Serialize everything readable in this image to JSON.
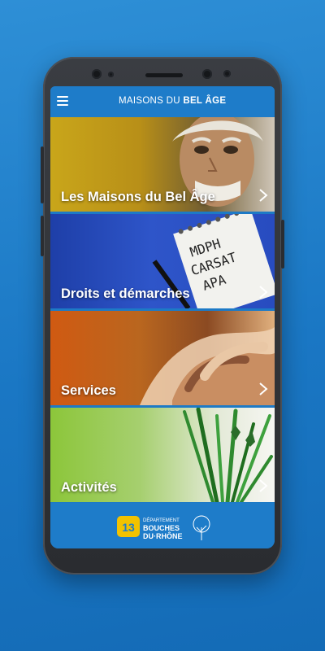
{
  "app": {
    "brand_part1": "MAISONS DU",
    "brand_part2": "BEL ÂGE"
  },
  "tiles": [
    {
      "label": "Les Maisons du Bel Âge"
    },
    {
      "label": "Droits et démarches"
    },
    {
      "label": "Services"
    },
    {
      "label": "Activités"
    }
  ],
  "notepad": {
    "line1": "MDPH",
    "line2": "CARSAT",
    "line3": "APA"
  },
  "footer": {
    "dept_label": "DÉPARTEMENT",
    "dept_name1": "BOUCHES",
    "dept_name2": "DU·RHÔNE",
    "logo_letter": "13"
  },
  "colors": {
    "background": "#1a77c4",
    "app_bar": "#1e7cc9",
    "logo_yellow": "#f2c200"
  }
}
